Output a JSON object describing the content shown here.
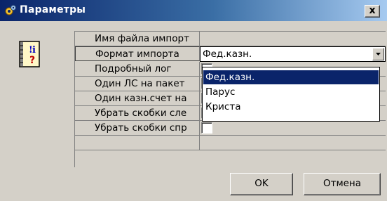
{
  "window": {
    "title": "Параметры",
    "close_symbol": "x",
    "app_icon": "gear-icon",
    "side_icon": "info-question-book-icon"
  },
  "params": [
    {
      "name": "Имя файла импорт",
      "kind": "text",
      "value": ""
    },
    {
      "name": "Формат импорта",
      "kind": "combo",
      "value": "Фед.казн."
    },
    {
      "name": "Подробный лог",
      "kind": "checkbox",
      "checked": false
    },
    {
      "name": "Один ЛС на пакет",
      "kind": "checkbox",
      "checked": false
    },
    {
      "name": "Один казн.счет на",
      "kind": "checkbox",
      "checked": false
    },
    {
      "name": "Убрать скобки сле",
      "kind": "checkbox",
      "checked": false
    },
    {
      "name": "Убрать скобки спр",
      "kind": "checkbox",
      "checked": false
    }
  ],
  "dropdown": {
    "options": [
      "Фед.казн.",
      "Парус",
      "Криста"
    ],
    "selected_index": 0
  },
  "buttons": {
    "ok": "OK",
    "cancel": "Отмена"
  },
  "colors": {
    "title_start": "#0a246a",
    "title_end": "#a6caf0",
    "dialog_face": "#d4d0c8",
    "selection": "#0a246a"
  }
}
